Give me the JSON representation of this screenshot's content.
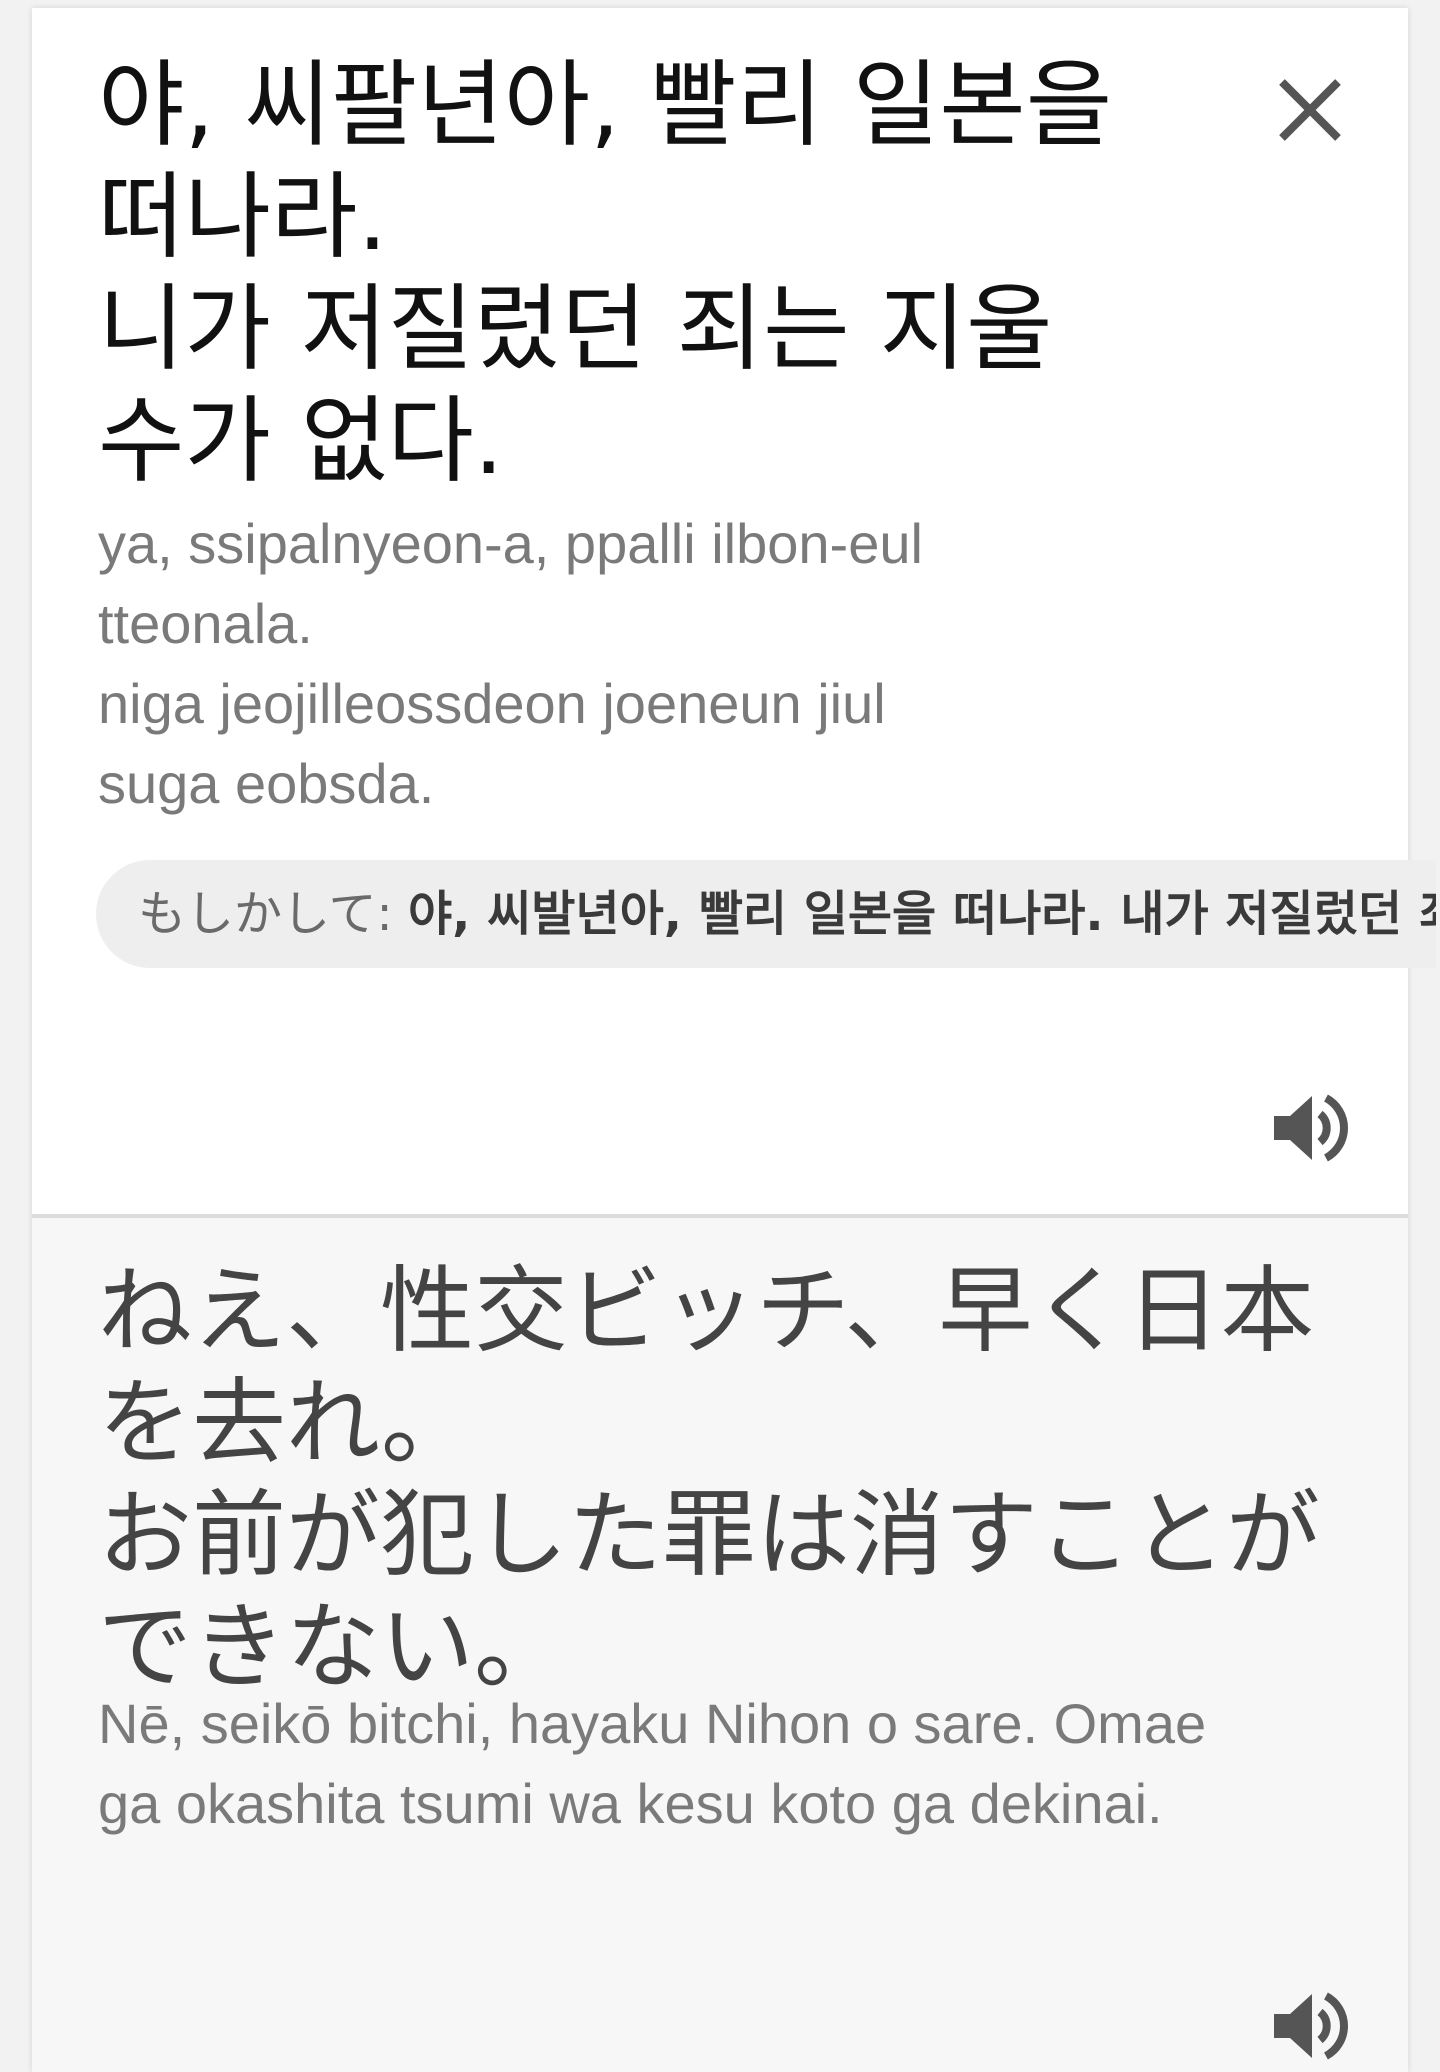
{
  "source": {
    "text_lines": [
      "야, 씨팔년아, 빨리 일본을",
      "떠나라.",
      "니가 저질렀던 죄는 지울",
      "수가 없다."
    ],
    "romanization_lines": [
      "ya, ssipalnyeon-a, ppalli ilbon-eul",
      "tteonala.",
      "niga jeojilleossdeon joeneun jiul",
      "suga eobsda."
    ],
    "close_icon": "close-icon",
    "speaker_icon": "speaker-icon"
  },
  "suggestion": {
    "prefix": "もしかして: ",
    "text": "야, 씨발년아, 빨리 일본을 떠나라. 내가 저질렀던 죄는 지울 수가 없다."
  },
  "target": {
    "text_lines": [
      "ねえ、性交ビッチ、早く日本",
      "を去れ。",
      "お前が犯した罪は消すことが",
      "できない。"
    ],
    "romanization_lines": [
      "Nē, seikō bitchi, hayaku Nihon o sare. Omae",
      "ga okashita tsumi wa kesu koto ga dekinai."
    ],
    "speaker_icon": "speaker-icon"
  },
  "colors": {
    "source_text": "#111111",
    "target_text": "#444444",
    "romanization": "#7a7a7a",
    "icon": "#555555",
    "suggestion_bg": "#eeeeee",
    "target_bg": "#f7f7f7"
  }
}
